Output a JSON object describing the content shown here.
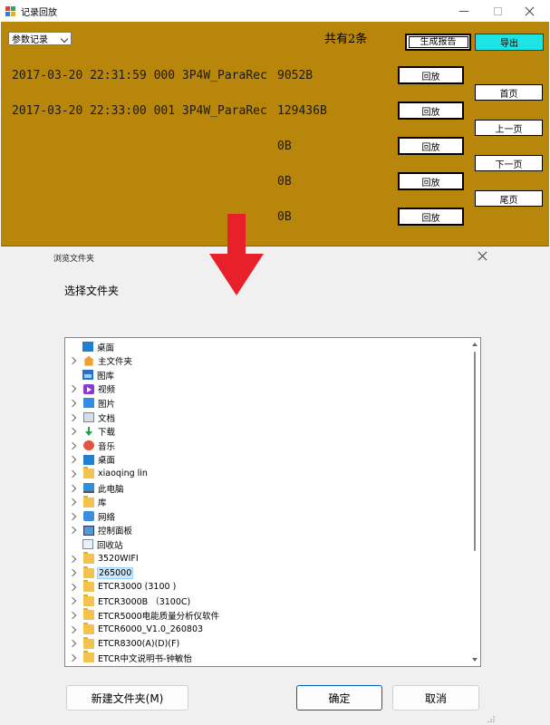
{
  "window": {
    "title": "记录回放",
    "record_type": "参数记录",
    "record_count": "共有2条",
    "report_button": "生成报告",
    "export_button": "导出",
    "records": [
      {
        "date": "2017-03-20",
        "time": "22:31:59",
        "index": "000",
        "name": "3P4W_ParaRec",
        "size": "9052B",
        "playback": "回放"
      },
      {
        "date": "2017-03-20",
        "time": "22:33:00",
        "index": "001",
        "name": "3P4W_ParaRec",
        "size": "129436B",
        "playback": "回放"
      },
      {
        "date": "",
        "time": "",
        "index": "",
        "name": "",
        "size": "0B",
        "playback": "回放"
      },
      {
        "date": "",
        "time": "",
        "index": "",
        "name": "",
        "size": "0B",
        "playback": "回放"
      },
      {
        "date": "",
        "time": "",
        "index": "",
        "name": "",
        "size": "0B",
        "playback": "回放"
      }
    ],
    "pager": {
      "first": "首页",
      "prev": "上一页",
      "next": "下一页",
      "last": "尾页"
    },
    "panel_color": "#b8860b",
    "export_color": "#1ee5e5"
  },
  "dialog": {
    "title": "浏览文件夹",
    "prompt": "选择文件夹",
    "tree": [
      {
        "label": "桌面",
        "icon": "desktop-icon",
        "expander": false
      },
      {
        "label": "主文件夹",
        "icon": "home-icon",
        "expander": true
      },
      {
        "label": "图库",
        "icon": "gallery-icon",
        "expander": false
      },
      {
        "label": "视频",
        "icon": "video-icon",
        "expander": true
      },
      {
        "label": "图片",
        "icon": "picture-icon",
        "expander": true
      },
      {
        "label": "文档",
        "icon": "document-icon",
        "expander": true
      },
      {
        "label": "下载",
        "icon": "download-icon",
        "expander": true
      },
      {
        "label": "音乐",
        "icon": "music-icon",
        "expander": true
      },
      {
        "label": "桌面",
        "icon": "desktop-icon",
        "expander": true
      },
      {
        "label": "xiaoqing lin",
        "icon": "folder-icon",
        "expander": true
      },
      {
        "label": "此电脑",
        "icon": "computer-icon",
        "expander": true
      },
      {
        "label": "库",
        "icon": "folder-icon",
        "expander": true
      },
      {
        "label": "网络",
        "icon": "network-icon",
        "expander": true
      },
      {
        "label": "控制面板",
        "icon": "control-panel-icon",
        "expander": true
      },
      {
        "label": "回收站",
        "icon": "recycle-bin-icon",
        "expander": false
      },
      {
        "label": "3520WIFI",
        "icon": "folder-icon",
        "expander": true
      },
      {
        "label": "265000",
        "icon": "folder-icon",
        "expander": true,
        "selected": true
      },
      {
        "label": "ETCR3000 (3100 )",
        "icon": "folder-icon",
        "expander": true
      },
      {
        "label": "ETCR3000B （3100C)",
        "icon": "folder-icon",
        "expander": true
      },
      {
        "label": "ETCR5000电能质量分析仪软件",
        "icon": "folder-icon",
        "expander": true
      },
      {
        "label": "ETCR6000_V1.0_260803",
        "icon": "folder-icon",
        "expander": true
      },
      {
        "label": "ETCR8300(A)(D)(F)",
        "icon": "folder-icon",
        "expander": true
      },
      {
        "label": "ETCR中文说明书-钟敏怡",
        "icon": "folder-icon",
        "expander": true
      }
    ],
    "new_folder_button": "新建文件夹(M)",
    "ok_button": "确定",
    "cancel_button": "取消"
  }
}
